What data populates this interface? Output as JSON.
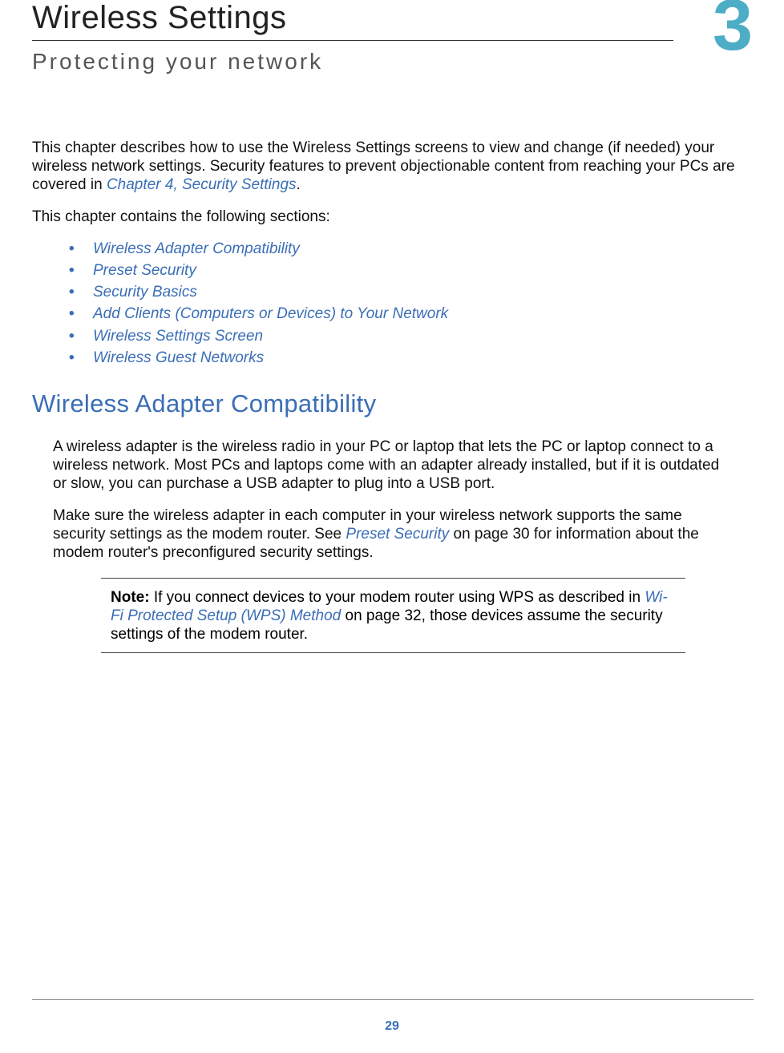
{
  "chapter": {
    "title": "Wireless Settings",
    "number": "3",
    "subtitle": "Protecting your network"
  },
  "intro": {
    "p1_a": "This chapter describes how to use the Wireless Settings screens to view and change (if needed) your wireless network settings. Security features to prevent objectionable content from reaching your PCs are covered in ",
    "p1_link": "Chapter 4, Security Settings",
    "p1_b": ".",
    "p2": "This chapter contains the following sections:"
  },
  "toc": {
    "item1": "Wireless Adapter Compatibility",
    "item2": "Preset Security",
    "item3": "Security Basics",
    "item4": "Add Clients (Computers or Devices) to Your Network",
    "item5": "Wireless Settings Screen",
    "item6": "Wireless Guest Networks"
  },
  "section1": {
    "heading": "Wireless Adapter Compatibility",
    "p1": "A wireless adapter is the wireless radio in your PC or laptop that lets the PC or laptop connect to a wireless network. Most PCs and laptops come with an adapter already installed, but if it is outdated or slow, you can purchase a USB adapter to plug into a USB port.",
    "p2_a": "Make sure the wireless adapter in each computer in your wireless network supports the same security settings as the modem router. See ",
    "p2_link": "Preset Security",
    "p2_b": " on page 30 for information about the modem router's preconfigured security settings."
  },
  "note": {
    "label": "Note:  ",
    "line_a": "If you connect devices to your modem router using WPS as described in ",
    "line_link": "Wi-Fi Protected Setup (WPS) Method",
    "line_b": " on page 32, those devices assume the security settings of the modem router."
  },
  "footer": {
    "page": "29"
  }
}
